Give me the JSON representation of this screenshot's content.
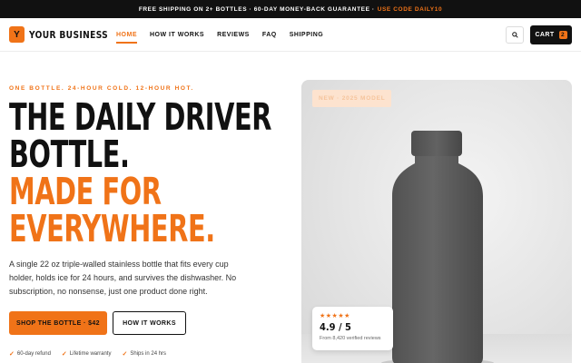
{
  "announcement": {
    "text": "FREE SHIPPING ON 2+ BOTTLES · 60-DAY MONEY-BACK GUARANTEE ·",
    "code": "USE CODE DAILY10"
  },
  "header": {
    "logo_letter": "Y",
    "brand": "YOUR BUSINESS",
    "nav": [
      {
        "label": "HOME",
        "active": true
      },
      {
        "label": "HOW IT WORKS",
        "active": false
      },
      {
        "label": "REVIEWS",
        "active": false
      },
      {
        "label": "FAQ",
        "active": false
      },
      {
        "label": "SHIPPING",
        "active": false
      }
    ],
    "search_icon": "search-icon",
    "cart_label": "CART",
    "cart_count": "2"
  },
  "hero": {
    "eyebrow": "ONE BOTTLE. 24-HOUR COLD. 12-HOUR HOT.",
    "headline_line1": "THE DAILY DRIVER",
    "headline_line2": "BOTTLE.",
    "headline_line3": "MADE FOR",
    "headline_line4": "EVERYWHERE.",
    "description": "A single 22 oz triple-walled stainless bottle that fits every cup holder, holds ice for 24 hours, and survives the dishwasher. No subscription, no nonsense, just one product done right.",
    "cta_primary": "SHOP THE BOTTLE · $42",
    "cta_secondary": "HOW IT WORKS",
    "perks": [
      "60-day refund",
      "Lifetime warranty",
      "Ships in 24 hrs"
    ],
    "image_tag": "NEW · 2025 MODEL",
    "rating": {
      "stars": "★★★★★",
      "score": "4.9 / 5",
      "subtext": "From 8,420 verified reviews"
    }
  },
  "colors": {
    "accent": "#f07318",
    "dark": "#111111",
    "bottle": "#5f5f5f"
  }
}
